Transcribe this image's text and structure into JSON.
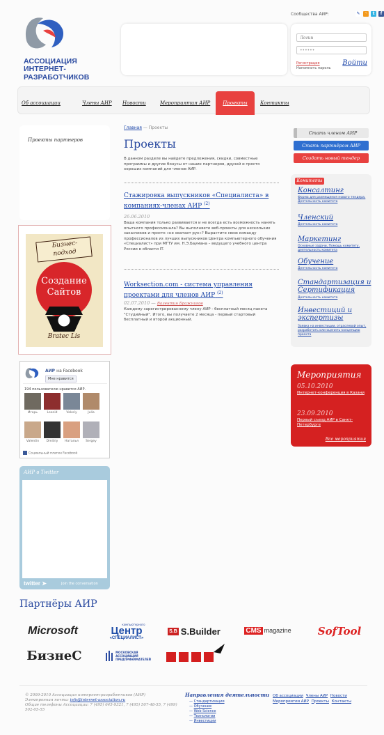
{
  "header": {
    "logo_line1": "АССОЦИАЦИЯ",
    "logo_line2": "ИНТЕРНЕТ-РАЗРАБОТЧИКОВ",
    "community_label": "Сообщества АИР:"
  },
  "login": {
    "login_placeholder": "Логин",
    "password_value": "••••••",
    "register": "Регистрация",
    "forgot": "Напомнить пароль",
    "submit": "Войти"
  },
  "nav": {
    "items": [
      "Об ассоциации",
      "Члены АИР",
      "Новости",
      "Мероприятия АИР",
      "Проекты",
      "Контакты"
    ]
  },
  "left": {
    "partners_projects": "Проекты партнеров",
    "ad": {
      "line1": "Бизнес-",
      "line2": "подход",
      "line3": "Создание",
      "line4": "Сайтов",
      "brand": "Bratec Lis"
    }
  },
  "facebook": {
    "page_name": "АИР",
    "on_facebook": "на Facebook",
    "like": "Мне нравится",
    "count_text": "194 пользователю нравится АИР.",
    "people": [
      "Игорь",
      "Leonid",
      "Valeriy",
      "Julia",
      "Valentin",
      "Dmitriy",
      "Наталья",
      "Sergey"
    ],
    "plugin": "Социальный плагин Facebook"
  },
  "twitter": {
    "title": "АИР в Twitter",
    "logo": "twitter",
    "join": "Join the conversation"
  },
  "main": {
    "breadcrumb_home": "Главная",
    "breadcrumb_sep": "—",
    "breadcrumb_current": "Проекты",
    "title": "Проекты",
    "intro": "В данном разделе вы найдете предложения, скидки, совместные программы и другие бонусы от наших партнеров, друзей и просто хороших компаний для членов АИР.",
    "articles": [
      {
        "title": "Стажировка выпускников «Специалиста» в компаниях-членах АИР",
        "count": "(2)",
        "date": "26.06.2010",
        "author": "",
        "text": "Ваша компания только развивается и не всегда есть возможность нанять опытного профессионала? Вы выполняете веб-проекты для нескольких заказчиков и просто «не хватает рук»? Вырастите свою команду профессионалов из лучших выпускников Центра компьютерного обучения «Специалист» при МГТУ им. Н.Э.Баумана – ведущего учебного центра России в области IT."
      },
      {
        "title": "Worksection.com - система управления проектами для членов АИР",
        "count": "(2)",
        "date": "02.07.2010 —",
        "author": "Валентин Бражников",
        "text": "Каждому зарегистрированному члену АИР - бесплатный месяц пакета \"Студийный\". Итого, вы получаете 2 месяца - первый стартовый бесплатный и второй акционный."
      }
    ]
  },
  "right": {
    "btn_member": "Стать членом АИР",
    "btn_partner": "Стать партнёром АИР",
    "btn_tender": "Создать новый тендер",
    "committees_label": "Комитеты",
    "committees": [
      {
        "name": "Консалтинг",
        "sub": "Форма для размещения нового тендера, Деятельность комитета"
      },
      {
        "name": "Членский",
        "sub": "Деятельность комитета"
      },
      {
        "name": "Маркетинг",
        "sub": "Основные задачи, Помощь комитету, деятельность комитета"
      },
      {
        "name": "Обучение",
        "sub": "Деятельность комитета"
      },
      {
        "name": "Стандартизация и Сертификация",
        "sub": "Деятельность комитета"
      },
      {
        "name": "Инвестиций и экспертизы",
        "sub": "Заявка на инвестиции, отраслевой опыт, разработать или оценить концепцию проекта"
      }
    ],
    "events_title": "Мероприятия",
    "events": [
      {
        "date": "05.10.2010",
        "name": "Интернет-конференция в Казани"
      },
      {
        "date": "23.09.2010",
        "name": "Первый съезд АИР в Санкт-Петербурге"
      }
    ],
    "events_all": "Все мероприятия"
  },
  "partners": {
    "title": "Партнёры АИР",
    "logos": [
      "Microsoft",
      "Центр компьютерного обучения «Специалист»",
      "S.Builder",
      "CMS magazine",
      "SofTool",
      "БизнеС",
      "Московская ассоциация предпринимателей",
      "Кремль"
    ],
    "small": {
      "centr_top": "компьютерного",
      "centr": "Центр",
      "centr_sub": "обучения",
      "spec": "«СПЕЦИАЛИСТ»",
      "sb": "S.B",
      "sbuilder": "S.Builder",
      "cms": "CMS",
      "magazine": "magazine",
      "softool": "SofTool",
      "biznes": "БизнеС",
      "mos1": "МОСКОВСКАЯ",
      "mos2": "АССОЦИАЦИЯ",
      "mos3": "ПРЕДПРИНИМАТЕЛЕЙ",
      "microsoft": "Microsoft"
    }
  },
  "footer": {
    "copyright": "© 2009-2010 Ассоциация интернет-разработчиков (АИР)",
    "email_label": "Электронная почта:",
    "email": "info@internet-association.ru",
    "phones": "Общие телефоны Ассоциации: 7 (495) 645-9321, 7 (495) 507-48-55, 7 (499) 502-05-55",
    "directions_title": "Направления деятельности",
    "directions": [
      "Стандартизация",
      "Обучение",
      "Web Science",
      "Технологии",
      "Инвестиции"
    ],
    "links": [
      "Об ассоциации",
      "Члены АИР",
      "Новости",
      "Мероприятия АИР",
      "Проекты",
      "Контакты"
    ]
  },
  "colors": {
    "accent_red": "#e8413f",
    "link_blue": "#1a44a8",
    "title_blue": "#2a4aa0"
  }
}
